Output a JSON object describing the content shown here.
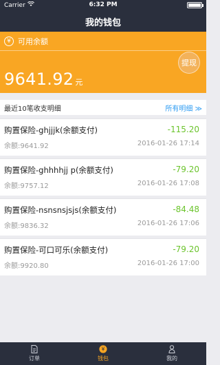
{
  "status_bar": {
    "carrier": "Carrier",
    "time": "6:32 PM"
  },
  "header": {
    "title": "我的钱包"
  },
  "balance": {
    "label": "可用余额",
    "amount": "9641.92",
    "unit": "元",
    "withdraw_label": "提现"
  },
  "list": {
    "title": "最近10笔收支明细",
    "all_link": "所有明细 ≫",
    "transactions": [
      {
        "name": "购置保险-ghjjjk(余额支付)",
        "amount": "-115.20",
        "balance": "余额:9641.92",
        "date": "2016-01-26 17:14"
      },
      {
        "name": "购置保险-ghhhhjj p(余额支付)",
        "amount": "-79.20",
        "balance": "余额:9757.12",
        "date": "2016-01-26 17:08"
      },
      {
        "name": "购置保险-nsnsnsjsjs(余额支付)",
        "amount": "-84.48",
        "balance": "余额:9836.32",
        "date": "2016-01-26 17:06"
      },
      {
        "name": "购置保险-可口可乐(余额支付)",
        "amount": "-79.20",
        "balance": "余额:9920.80",
        "date": "2016-01-26 17:00"
      }
    ]
  },
  "tabs": [
    {
      "label": "订单",
      "icon": "document-icon"
    },
    {
      "label": "钱包",
      "icon": "yen-coin-icon"
    },
    {
      "label": "我的",
      "icon": "person-icon"
    }
  ],
  "colors": {
    "accent": "#f9a623",
    "nav": "#2a2f3d",
    "positive_amount": "#6bc42c",
    "link": "#2f9cf2"
  }
}
